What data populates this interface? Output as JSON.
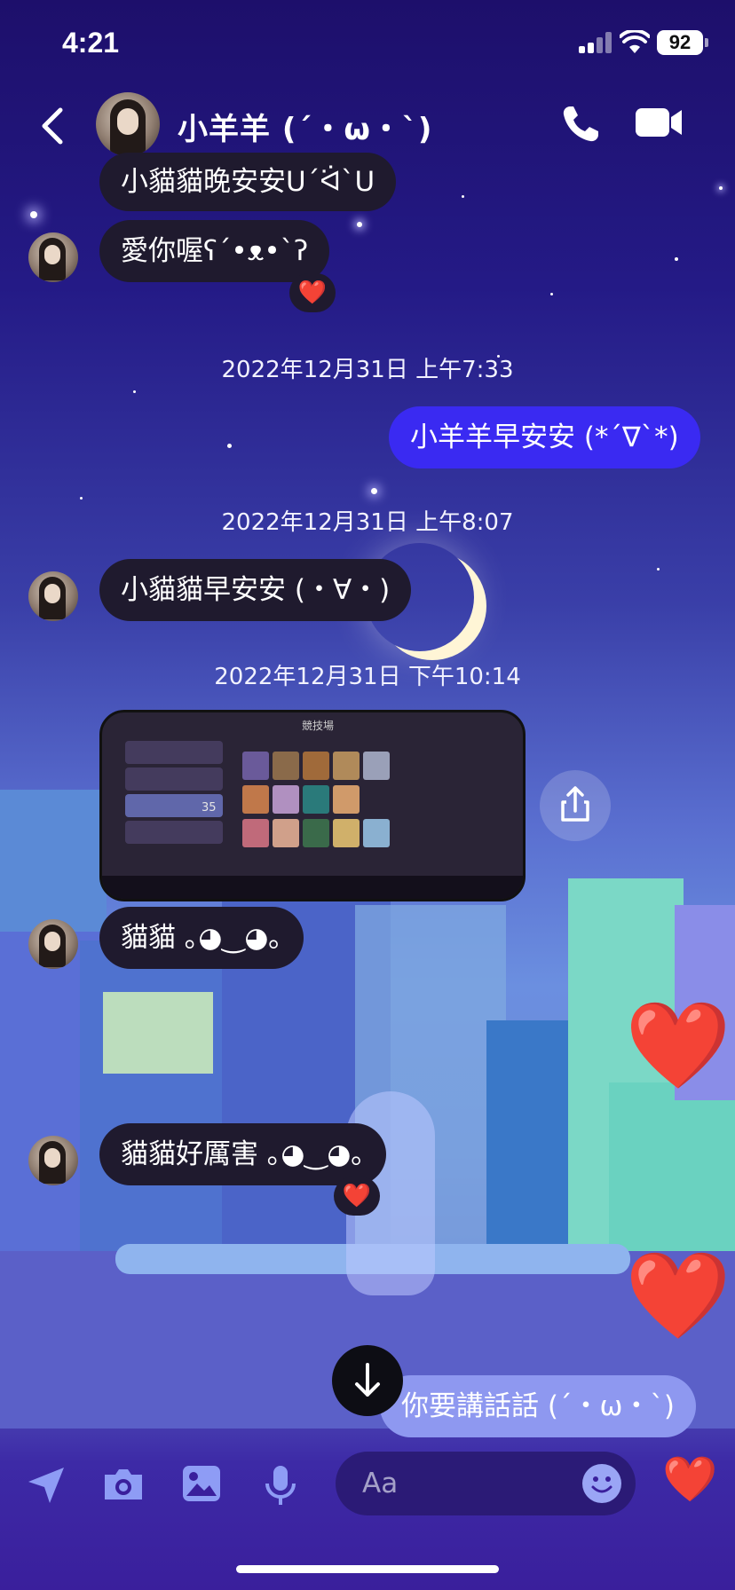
{
  "status_bar": {
    "time": "4:21",
    "battery": "92"
  },
  "header": {
    "contact_name": "小羊羊 (´・ω・`)"
  },
  "messages": [
    {
      "text": "小貓貓晚安安ᑌ´ᐛ`ᑌ"
    },
    {
      "text": "愛你喔ʕ´•ᴥ•`ʔ",
      "reaction": "❤️"
    },
    {
      "timestamp": "2022年12月31日 上午7:33"
    },
    {
      "text": "小羊羊早安安 (*´∇`*)"
    },
    {
      "timestamp": "2022年12月31日 上午8:07"
    },
    {
      "text": "小貓貓早安安 (・∀・)"
    },
    {
      "timestamp": "2022年12月31日 下午10:14"
    },
    {
      "photo_title": "競技場",
      "photo_number": "35"
    },
    {
      "text": "貓貓 ｡◕‿◕｡"
    },
    {
      "text": "貓貓好厲害 ｡◕‿◕｡",
      "reaction": "❤️"
    },
    {
      "text": "你要講話話 (´・ω・`)"
    }
  ],
  "big_hearts": [
    "❤️",
    "❤️"
  ],
  "composer": {
    "placeholder": "Aa",
    "like": "❤️"
  },
  "colors": {
    "outgoing": "#3a2af2",
    "incoming": "#1f1a2e",
    "heart": "#ff2a36"
  },
  "icons": [
    "back-icon",
    "phone-icon",
    "video-icon",
    "share-icon",
    "arrow-down-icon",
    "location-icon",
    "camera-icon",
    "gallery-icon",
    "microphone-icon",
    "emoji-icon",
    "heart-icon"
  ]
}
